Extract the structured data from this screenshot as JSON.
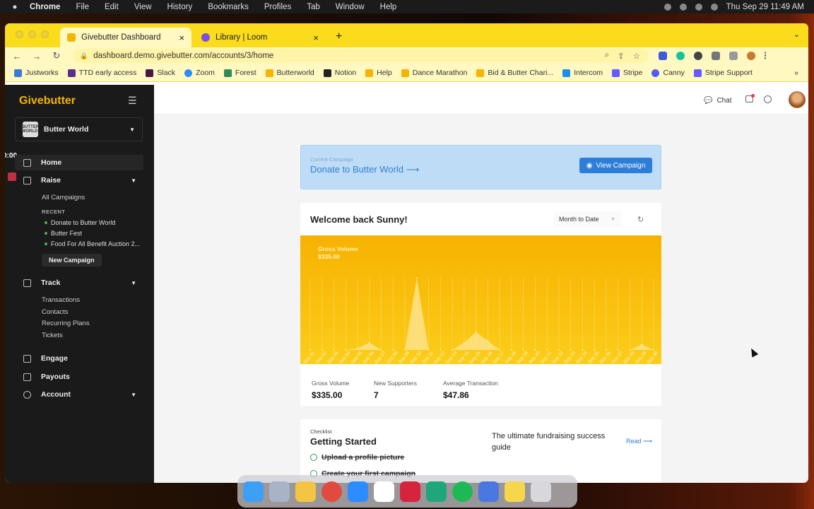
{
  "menubar": {
    "app": "Chrome",
    "items": [
      "File",
      "Edit",
      "View",
      "History",
      "Bookmarks",
      "Profiles",
      "Tab",
      "Window",
      "Help"
    ],
    "clock": "Thu Sep 29  11:49 AM"
  },
  "tabs": [
    {
      "label": "Givebutter Dashboard",
      "color": "#f5b400"
    },
    {
      "label": "Library | Loom",
      "color": "#7b4fe0"
    }
  ],
  "address": {
    "url": "dashboard.demo.givebutter.com/accounts/3/home"
  },
  "bookmarks": [
    {
      "label": "Justworks",
      "color": "#3a7bd5"
    },
    {
      "label": "TTD early access",
      "color": "#5a2d91"
    },
    {
      "label": "Slack",
      "color": "#4a154b"
    },
    {
      "label": "Zoom",
      "color": "#2d8cff"
    },
    {
      "label": "Forest",
      "color": "#2e8b57"
    },
    {
      "label": "Butterworld",
      "color": "#f5b400"
    },
    {
      "label": "Notion",
      "color": "#222222"
    },
    {
      "label": "Help",
      "color": "#f5b400"
    },
    {
      "label": "Dance Marathon",
      "color": "#f5b400"
    },
    {
      "label": "Bid & Butter Chari...",
      "color": "#f5b400"
    },
    {
      "label": "Intercom",
      "color": "#1f8ded"
    },
    {
      "label": "Stripe",
      "color": "#635bff"
    },
    {
      "label": "Canny",
      "color": "#525df9"
    },
    {
      "label": "Stripe Support",
      "color": "#635bff"
    }
  ],
  "sidebar": {
    "logo": "Givebutter",
    "org_name": "Butter World",
    "org_avatar": "BUTTER WORLD",
    "home": "Home",
    "raise": "Raise",
    "all_campaigns": "All Campaigns",
    "recent": "RECENT",
    "campaigns": [
      "Donate to Butter World",
      "Butter Fest",
      "Food For All Benefit Auction 2..."
    ],
    "new_campaign": "New Campaign",
    "track": "Track",
    "track_items": [
      "Transactions",
      "Contacts",
      "Recurring Plans",
      "Tickets"
    ],
    "engage": "Engage",
    "payouts": "Payouts",
    "account": "Account",
    "timer": "0:00"
  },
  "topbar": {
    "chat": "Chat"
  },
  "banner": {
    "label": "Current Campaign",
    "title": "Donate to Butter World ⟶",
    "button": "View Campaign"
  },
  "dashboard": {
    "welcome": "Welcome back Sunny!",
    "period": "Month to Date",
    "chart_label": "Gross Volume",
    "chart_value": "$335.00",
    "stats": [
      {
        "label": "Gross Volume",
        "value": "$335.00"
      },
      {
        "label": "New Supporters",
        "value": "7"
      },
      {
        "label": "Average Transaction",
        "value": "$47.86"
      }
    ]
  },
  "checklist": {
    "kicker": "Checklist",
    "title": "Getting Started",
    "items": [
      "Upload a profile picture",
      "Create your first campaign"
    ],
    "guide": "The ultimate fundraising success guide",
    "read": "Read ⟶"
  },
  "chart_data": {
    "type": "area",
    "title": "Gross Volume",
    "categories": [
      "Sep 01",
      "Sep 02",
      "Sep 03",
      "Sep 04",
      "Sep 05",
      "Sep 06",
      "Sep 07",
      "Sep 08",
      "Sep 09",
      "Sep 10",
      "Sep 11",
      "Sep 12",
      "Sep 13",
      "Sep 14",
      "Sep 15",
      "Sep 16",
      "Sep 17",
      "Sep 18",
      "Sep 19",
      "Sep 20",
      "Sep 21",
      "Sep 22",
      "Sep 23",
      "Sep 24",
      "Sep 25",
      "Sep 26",
      "Sep 27",
      "Sep 28",
      "Sep 29",
      "Sep 30"
    ],
    "values": [
      0,
      0,
      0,
      0,
      5,
      20,
      0,
      0,
      0,
      200,
      0,
      0,
      0,
      20,
      50,
      25,
      0,
      0,
      0,
      0,
      0,
      0,
      0,
      0,
      0,
      0,
      0,
      0,
      15,
      0
    ],
    "color": "#fde69a",
    "grid": true
  },
  "dock": [
    "Finder",
    "Launchpad",
    "Photos",
    "Chrome",
    "Zoom",
    "Slack",
    "Loom",
    "Arc",
    "Spotify",
    "Preview",
    "Notes",
    "Trash"
  ]
}
